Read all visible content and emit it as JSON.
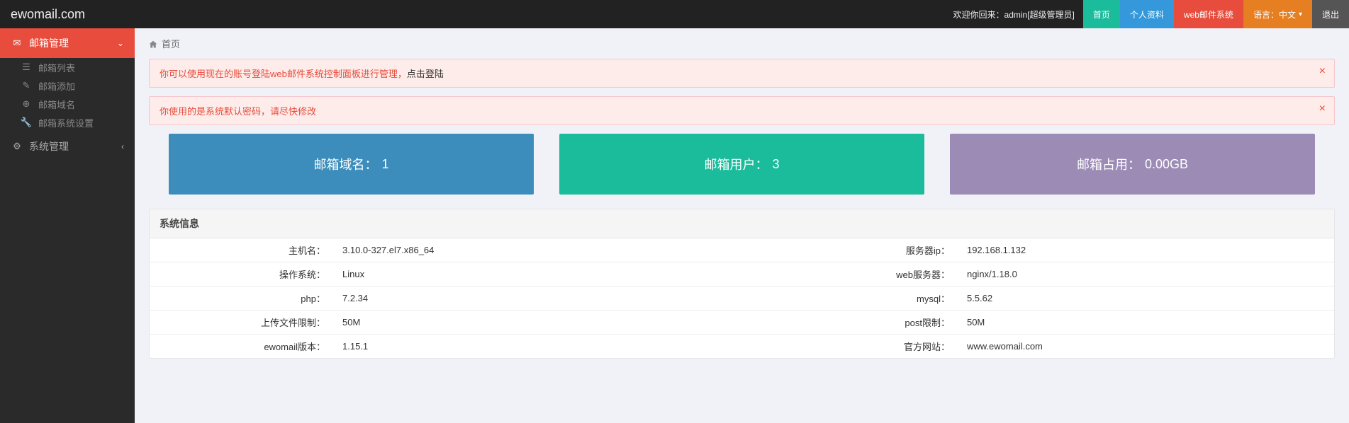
{
  "brand": "ewomail.com",
  "header": {
    "welcome_prefix": "欢迎你回来：",
    "username": "admin[超级管理员]",
    "nav": {
      "home": "首页",
      "profile": "个人资料",
      "webmail": "web邮件系统",
      "lang_label": "语言：中文",
      "logout": "退出"
    }
  },
  "sidebar": {
    "mail_mgmt": "邮箱管理",
    "items": [
      {
        "label": "邮箱列表"
      },
      {
        "label": "邮箱添加"
      },
      {
        "label": "邮箱域名"
      },
      {
        "label": "邮箱系统设置"
      }
    ],
    "sys_mgmt": "系统管理"
  },
  "breadcrumb": {
    "home": "首页"
  },
  "alerts": {
    "login_webmail_red": "你可以使用现在的账号登陆web邮件系统控制面板进行管理，",
    "login_webmail_link": "点击登陆",
    "default_pwd": "你使用的是系统默认密码，请尽快修改"
  },
  "stats": {
    "domain_label": "邮箱域名：",
    "domain_value": "1",
    "user_label": "邮箱用户：",
    "user_value": "3",
    "usage_label": "邮箱占用：",
    "usage_value": "0.00GB"
  },
  "sysinfo": {
    "title": "系统信息",
    "rows": [
      {
        "k1": "主机名：",
        "v1": "3.10.0-327.el7.x86_64",
        "k2": "服务器ip：",
        "v2": "192.168.1.132"
      },
      {
        "k1": "操作系统：",
        "v1": "Linux",
        "k2": "web服务器：",
        "v2": "nginx/1.18.0"
      },
      {
        "k1": "php：",
        "v1": "7.2.34",
        "k2": "mysql：",
        "v2": "5.5.62"
      },
      {
        "k1": "上传文件限制：",
        "v1": "50M",
        "k2": "post限制：",
        "v2": "50M"
      },
      {
        "k1": "ewomail版本：",
        "v1": "1.15.1",
        "k2": "官方网站：",
        "v2": "www.ewomail.com"
      }
    ]
  }
}
